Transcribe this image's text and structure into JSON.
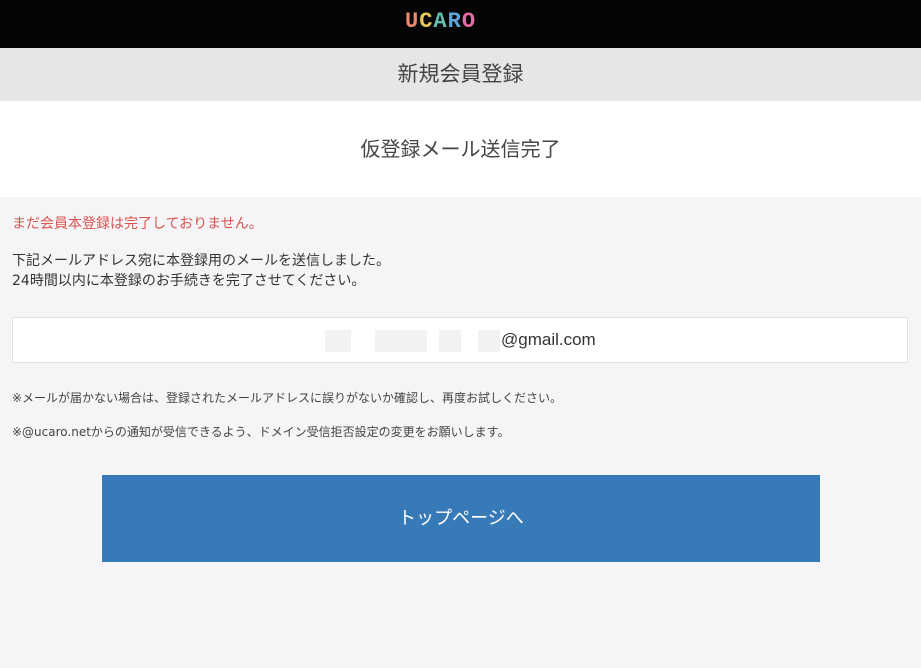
{
  "header": {
    "logo_letters": [
      {
        "char": "U",
        "color": "#e98a6c"
      },
      {
        "char": "C",
        "color": "#e7c75a"
      },
      {
        "char": "A",
        "color": "#61bfb0"
      },
      {
        "char": "R",
        "color": "#5ca3d8"
      },
      {
        "char": "O",
        "color": "#e86aa6"
      }
    ],
    "section_title": "新規会員登録"
  },
  "main": {
    "heading": "仮登録メール送信完了",
    "warning": "まだ会員本登録は完了しておりません。",
    "description_lines": [
      "下記メールアドレス宛に本登録用のメールを送信しました。",
      "24時間以内に本登録のお手続きを完了させてください。"
    ],
    "email_visible": "@gmail.com",
    "notes": [
      "※メールが届かない場合は、登録されたメールアドレスに誤りがないか確認し、再度お試しください。",
      "※@ucaro.netからの通知が受信できるよう、ドメイン受信拒否設定の変更をお願いします。"
    ],
    "top_page_button": "トップページへ"
  },
  "colors": {
    "header_bg": "#050505",
    "subheader_bg": "#e6e6e8",
    "warning": "#d9534f",
    "button_bg": "#377ab8"
  }
}
